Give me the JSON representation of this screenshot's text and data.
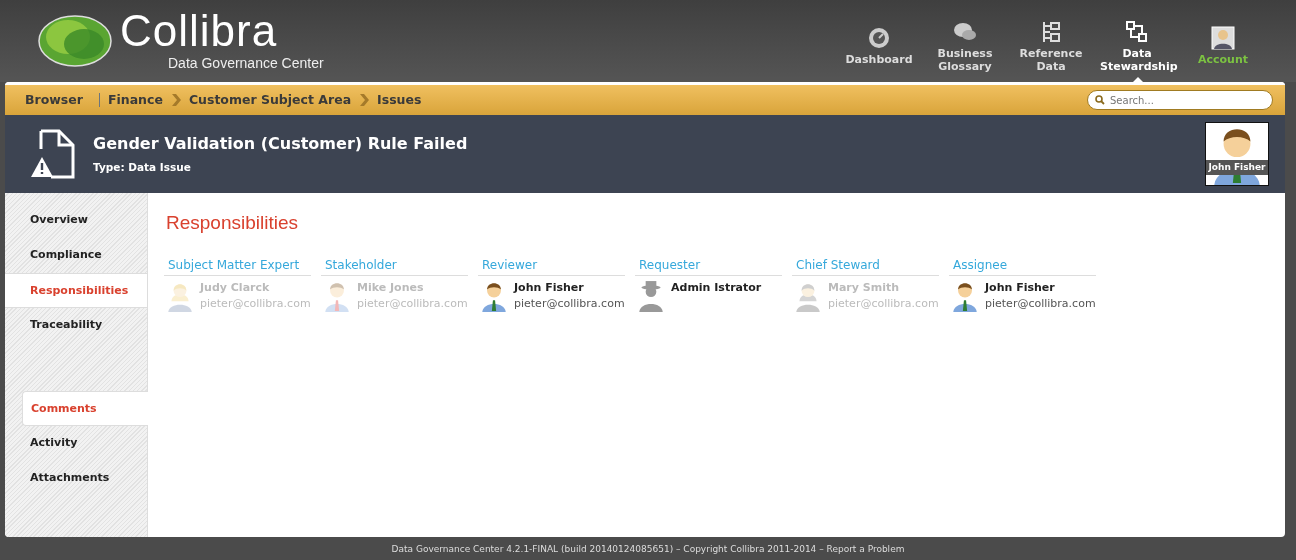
{
  "logo": {
    "name": "Collibra",
    "subtitle": "Data Governance Center"
  },
  "top_nav": [
    {
      "label": "Dashboard",
      "selected": false,
      "kind": "section"
    },
    {
      "label": "Business Glossary",
      "selected": false,
      "kind": "section"
    },
    {
      "label": "Reference Data",
      "selected": false,
      "kind": "section"
    },
    {
      "label": "Data Stewardship",
      "selected": true,
      "kind": "section"
    },
    {
      "label": "Account",
      "selected": false,
      "kind": "account"
    }
  ],
  "breadcrumb": [
    {
      "label": "Browser",
      "kind": "root"
    },
    {
      "label": "Finance",
      "kind": "crumb"
    },
    {
      "label": "Customer Subject Area",
      "kind": "crumb"
    },
    {
      "label": "Issues",
      "kind": "crumb"
    }
  ],
  "search": {
    "placeholder": "Search..."
  },
  "asset": {
    "title": "Gender Validation (Customer) Rule Failed",
    "type_label": "Type:",
    "type_value": "Data Issue",
    "owner": "John Fisher"
  },
  "sidebar": {
    "groups": [
      [
        {
          "label": "Overview",
          "selected": false
        },
        {
          "label": "Compliance",
          "selected": false
        },
        {
          "label": "Responsibilities",
          "selected": true
        },
        {
          "label": "Traceability",
          "selected": false
        }
      ],
      [
        {
          "label": "Comments",
          "selected": true
        },
        {
          "label": "Activity",
          "selected": false
        },
        {
          "label": "Attachments",
          "selected": false
        }
      ]
    ]
  },
  "section_title": "Responsibilities",
  "roles": [
    {
      "role": "Subject Matter Expert",
      "name": "Judy Clarck",
      "email": "pieter@collibra.com",
      "kind": "female",
      "inactive": true
    },
    {
      "role": "Stakeholder",
      "name": "Mike Jones",
      "email": "pieter@collibra.com",
      "kind": "male-red-tie",
      "inactive": true
    },
    {
      "role": "Reviewer",
      "name": "John Fisher",
      "email": "pieter@collibra.com",
      "kind": "male",
      "inactive": false
    },
    {
      "role": "Requester",
      "name": "Admin Istrator",
      "kind": "silhouette",
      "inactive": false
    },
    {
      "role": "Chief Steward",
      "name": "Mary Smith",
      "email": "pieter@collibra.com",
      "kind": "female-grey",
      "inactive": true
    },
    {
      "role": "Assignee",
      "name": "John Fisher",
      "email": "pieter@collibra.com",
      "kind": "male",
      "inactive": false
    }
  ],
  "footer": {
    "text": "Data Governance Center 4.2.1-FINAL (build 20140124085651) – Copyright Collibra 2011-2014 –",
    "link": "Report a Problem"
  }
}
